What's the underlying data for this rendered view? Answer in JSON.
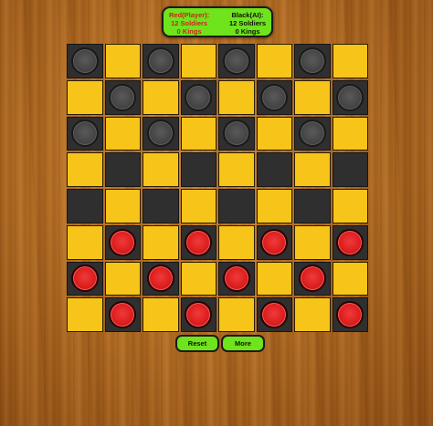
{
  "scoreboard": {
    "red": {
      "title": "Red(Player):",
      "soldiers": "12 Soldiers",
      "kings": "0 Kings"
    },
    "black": {
      "title": "Black(AI):",
      "soldiers": "12 Soldiers",
      "kings": "0 Kings"
    }
  },
  "colors": {
    "light_square": "#f7c51a",
    "dark_square": "#2f2f2f",
    "red_piece": "#dc1f1f",
    "black_piece": "#444444",
    "panel_green": "#6fe31c"
  },
  "board": {
    "rows": [
      [
        "b",
        ".",
        "b",
        ".",
        "b",
        ".",
        "b",
        "."
      ],
      [
        ".",
        "b",
        ".",
        "b",
        ".",
        "b",
        ".",
        "b"
      ],
      [
        "b",
        ".",
        "b",
        ".",
        "b",
        ".",
        "b",
        "."
      ],
      [
        ".",
        ".",
        ".",
        ".",
        ".",
        ".",
        ".",
        "."
      ],
      [
        ".",
        ".",
        ".",
        ".",
        ".",
        ".",
        ".",
        "."
      ],
      [
        ".",
        "r",
        ".",
        "r",
        ".",
        "r",
        ".",
        "r"
      ],
      [
        "r",
        ".",
        "r",
        ".",
        "r",
        ".",
        "r",
        "."
      ],
      [
        ".",
        "r",
        ".",
        "r",
        ".",
        "r",
        ".",
        "r"
      ]
    ]
  },
  "buttons": {
    "reset_label": "Reset",
    "more_label": "More"
  }
}
